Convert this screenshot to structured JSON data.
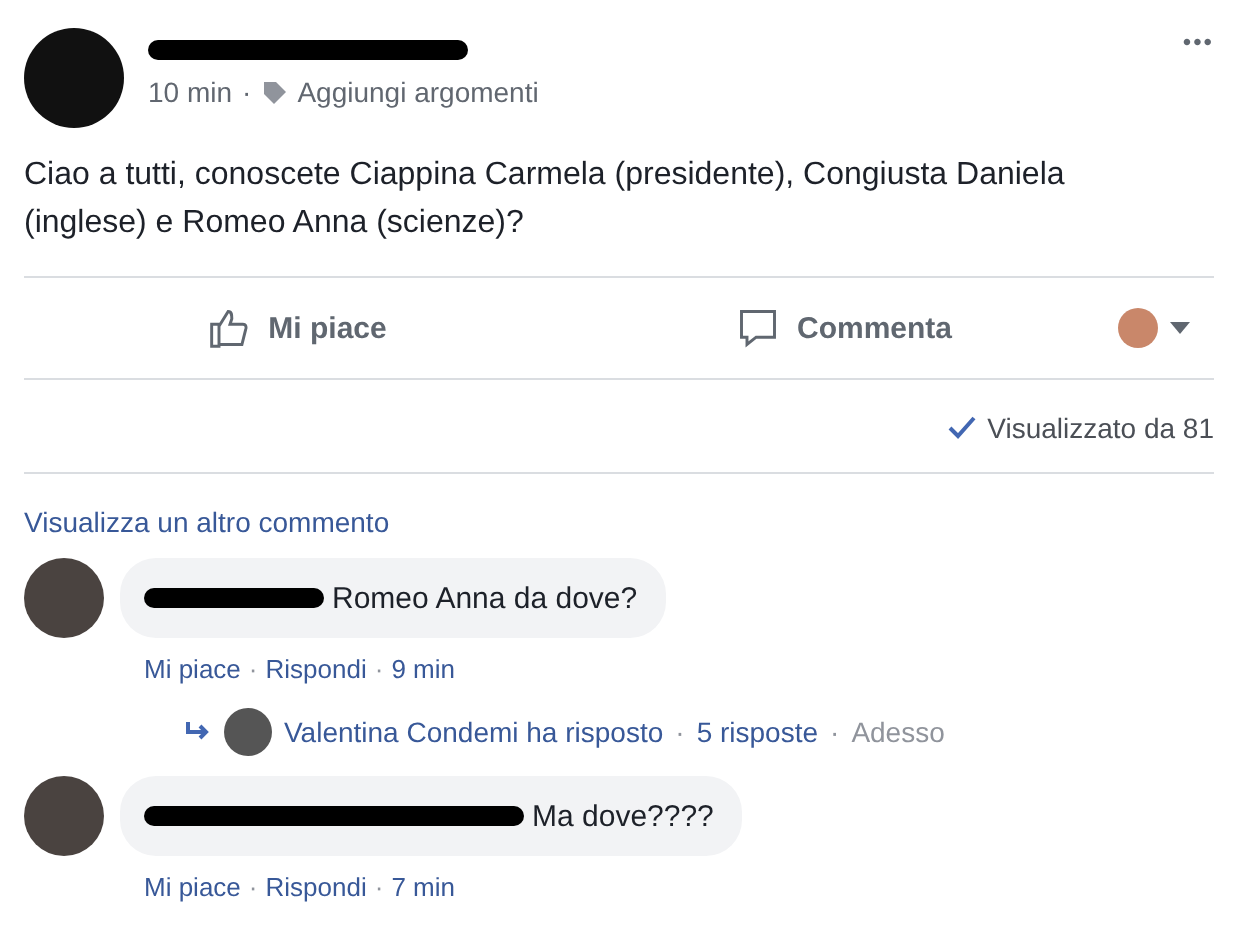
{
  "post": {
    "time": "10 min",
    "separator": "·",
    "topics": "Aggiungi argomenti",
    "more": "•••",
    "text": "Ciao a tutti, conoscete Ciappina Carmela (presidente), Congiusta Daniela (inglese) e Romeo Anna (scienze)?"
  },
  "actions": [
    {
      "kind": "like",
      "label": "Mi piace"
    },
    {
      "kind": "comment",
      "label": "Commenta"
    }
  ],
  "seen": "Visualizzato da 81",
  "more_comments": "Visualizza un altro commento",
  "comments": [
    {
      "text": "Romeo Anna da dove?",
      "actions": [
        "Mi piace",
        "Rispondi"
      ],
      "time": "9 min",
      "reply": {
        "text": "Valentina Condemi ha risposto",
        "count": "5 risposte",
        "time": "Adesso"
      }
    },
    {
      "text": "Ma dove????",
      "actions": [
        "Mi piace",
        "Rispondi"
      ],
      "time": "7 min"
    }
  ]
}
